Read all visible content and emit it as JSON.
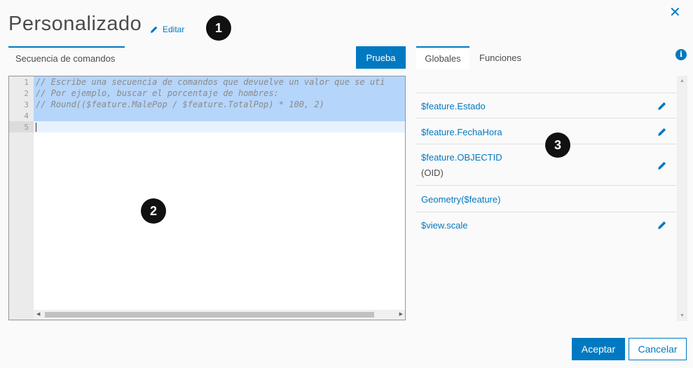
{
  "header": {
    "title": "Personalizado",
    "edit_label": "Editar",
    "close_symbol": "✕"
  },
  "callouts": [
    "1",
    "2",
    "3"
  ],
  "editor_tab": {
    "label": "Secuencia de comandos"
  },
  "test_button": {
    "label": "Prueba"
  },
  "editor": {
    "line_numbers": [
      "1",
      "2",
      "3",
      "4",
      "5"
    ],
    "lines": [
      "// Escribe una secuencia de comandos que devuelve un valor que se uti",
      "// Por ejemplo, buscar el porcentaje de hombres:",
      "// Round(($feature.MalePop / $feature.TotalPop) * 100, 2)",
      "",
      ""
    ]
  },
  "side_tabs": [
    {
      "label": "Globales",
      "active": true
    },
    {
      "label": "Funciones",
      "active": false
    }
  ],
  "info_symbol": "i",
  "globals": [
    {
      "label": "$feature.Estado",
      "sub": "",
      "editable": true
    },
    {
      "label": "$feature.FechaHora",
      "sub": "",
      "editable": true
    },
    {
      "label": "$feature.OBJECTID",
      "sub": "(OID)",
      "editable": true
    },
    {
      "label": "Geometry($feature)",
      "sub": "",
      "editable": false
    },
    {
      "label": "$view.scale",
      "sub": "",
      "editable": true
    }
  ],
  "footer": {
    "ok_label": "Aceptar",
    "cancel_label": "Cancelar"
  },
  "colors": {
    "accent": "#0079c1",
    "selection": "#b5d5fb"
  }
}
